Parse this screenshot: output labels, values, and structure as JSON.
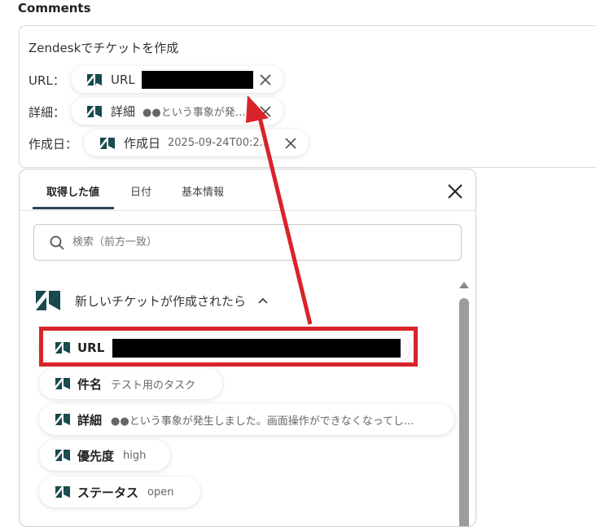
{
  "section": {
    "label": "Comments"
  },
  "comment": {
    "title": "Zendeskでチケットを作成",
    "url_label": "URL：",
    "detail_label": "詳細：",
    "created_label": "作成日：",
    "chips": {
      "url": {
        "label": "URL",
        "value": ""
      },
      "detail": {
        "label": "詳細",
        "value": "●●という事象が発生しました。"
      },
      "created": {
        "label": "作成日",
        "value": "2025-09-24T00:2..."
      }
    }
  },
  "panel": {
    "tabs": [
      {
        "label": "取得した値",
        "active": true
      },
      {
        "label": "日付",
        "active": false
      },
      {
        "label": "基本情報",
        "active": false
      }
    ],
    "search": {
      "placeholder": "検索（前方一致）"
    },
    "group": {
      "label": "新しいチケットが作成されたら"
    },
    "items": [
      {
        "label": "URL",
        "value": ""
      },
      {
        "label": "件名",
        "value": "テスト用のタスク"
      },
      {
        "label": "詳細",
        "value": "●●という事象が発生しました。画面操作ができなくなってし..."
      },
      {
        "label": "優先度",
        "value": "high"
      },
      {
        "label": "ステータス",
        "value": "open"
      }
    ]
  },
  "colors": {
    "brand_zendesk": "#17494d",
    "highlight": "#d9232a",
    "tab_underline": "#28465f"
  },
  "icons": [
    "zendesk-icon",
    "close-icon",
    "search-icon",
    "chevron-up-icon",
    "scroll-up-icon"
  ]
}
